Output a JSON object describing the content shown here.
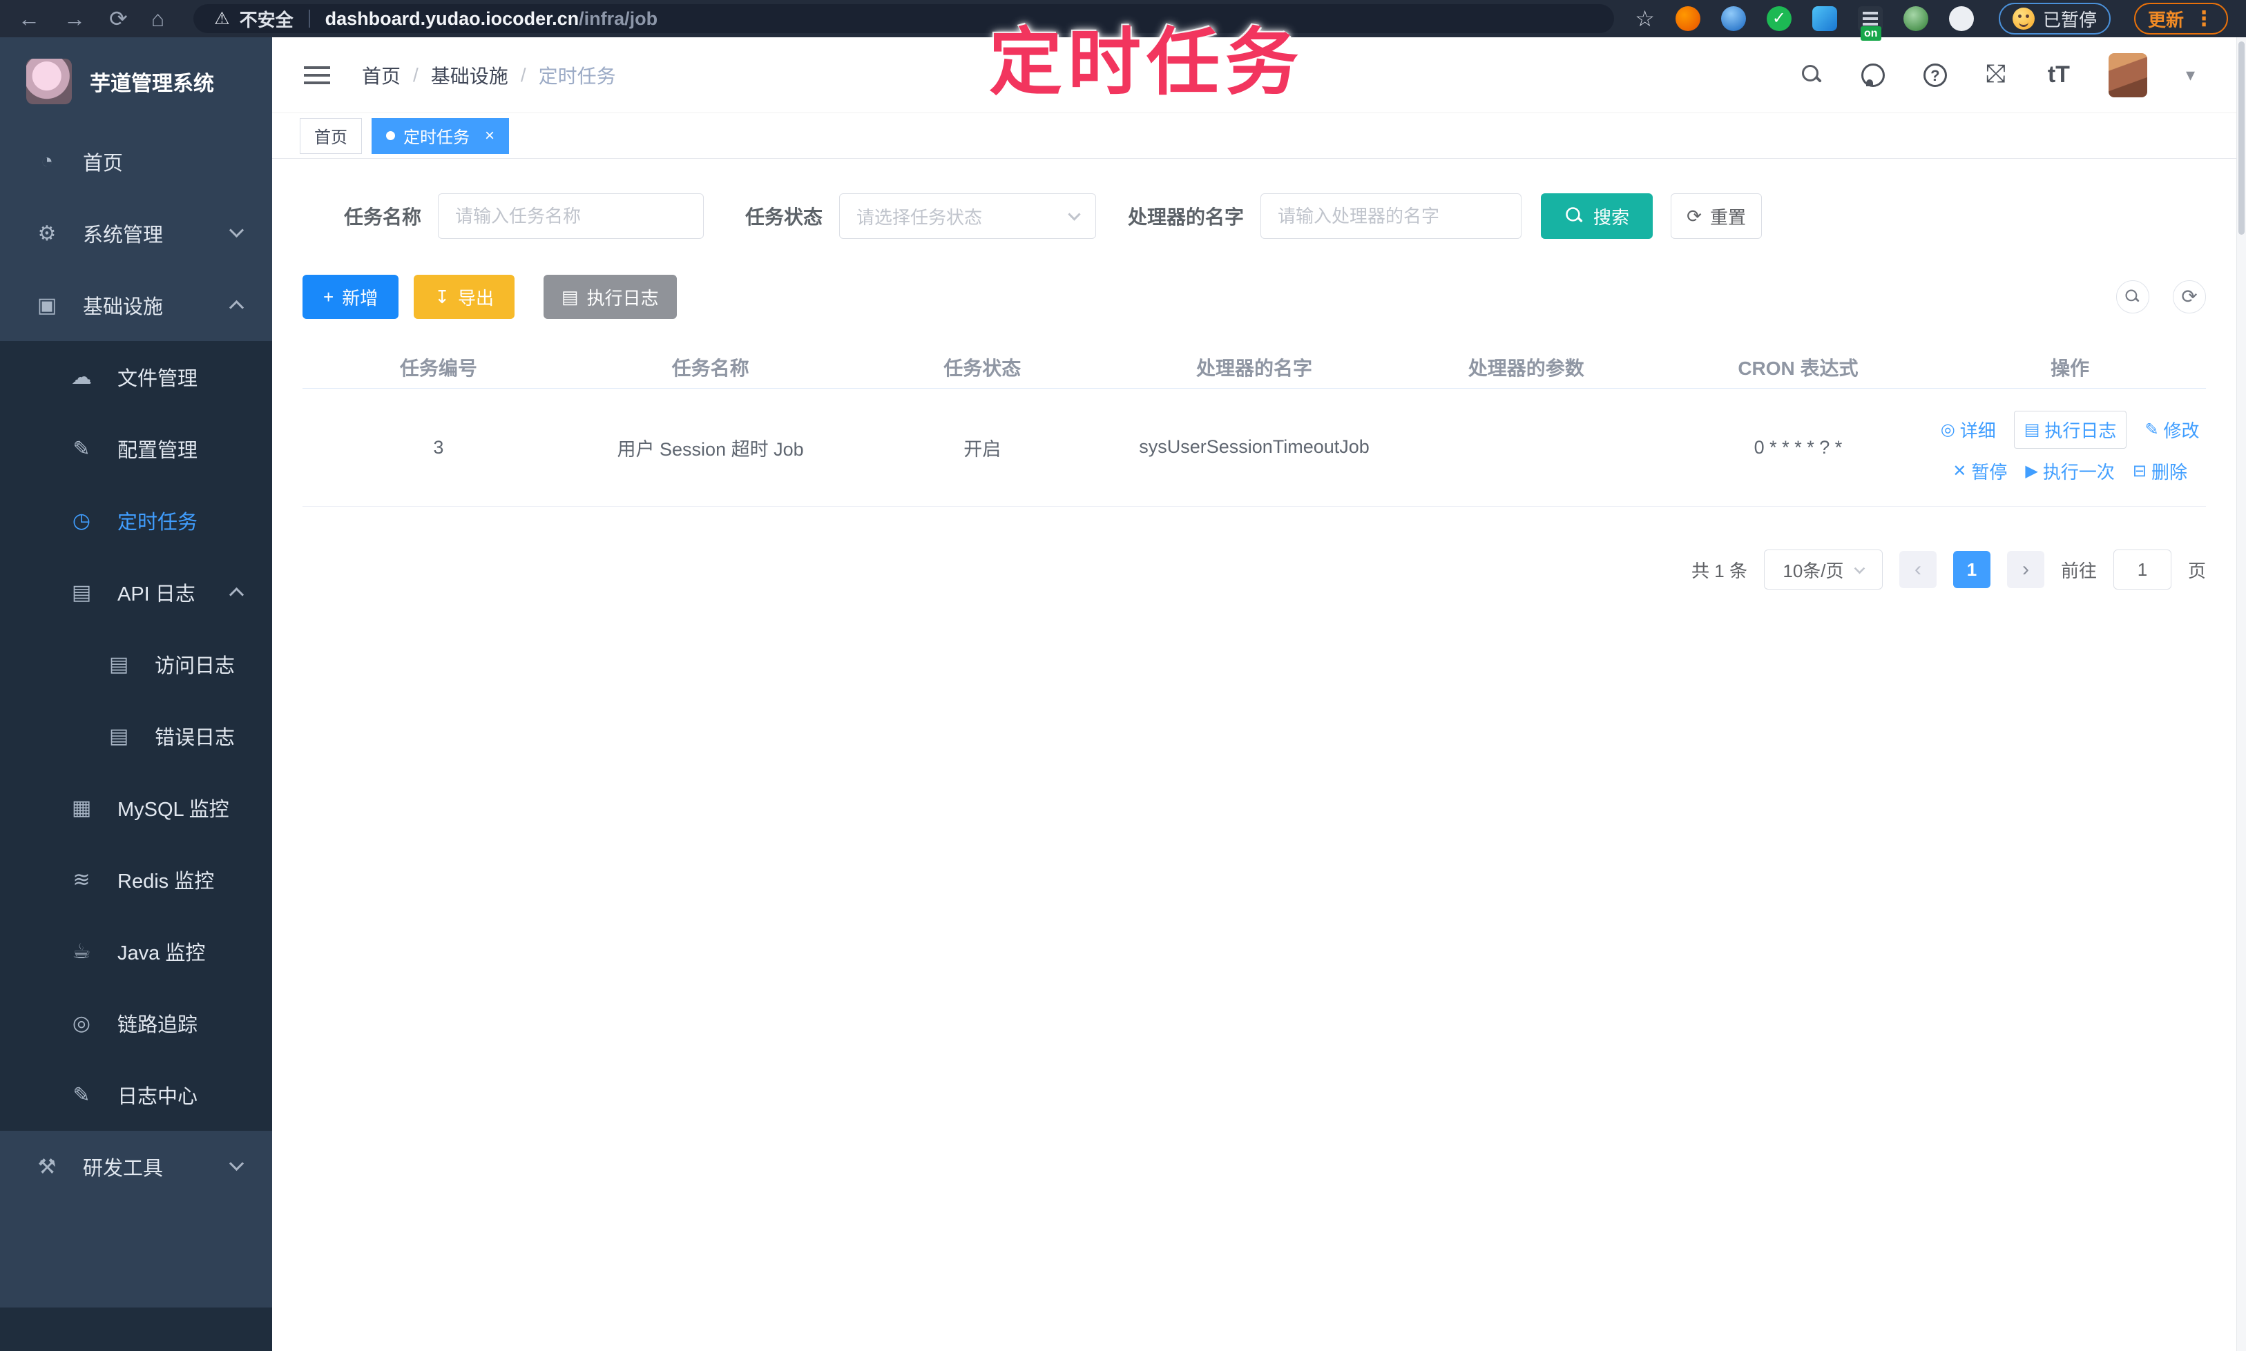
{
  "icons": {
    "back": "←",
    "forward": "→",
    "reload": "⟳",
    "home": "⌂",
    "warning": "⚠",
    "star": "☆",
    "kebab": "⋮",
    "check": "✓",
    "caret_down": "▾",
    "prev": "‹",
    "next": "›",
    "reset": "⟳",
    "add": "+",
    "export": "↧",
    "list": "▤",
    "close": "×"
  },
  "browser": {
    "security_label": "不安全",
    "url_host": "dashboard.yudao.iocoder.cn",
    "url_path": "/infra/job",
    "extension_badge": "on",
    "paused_label": "已暂停",
    "update_label": "更新"
  },
  "watermark": "定时任务",
  "sidebar": {
    "title": "芋道管理系统",
    "items": [
      {
        "label": "首页",
        "glyph": "◔"
      },
      {
        "label": "系统管理",
        "glyph": "⚙"
      },
      {
        "label": "基础设施",
        "glyph": "▣"
      },
      {
        "label": "文件管理",
        "glyph": "☁"
      },
      {
        "label": "配置管理",
        "glyph": "✎"
      },
      {
        "label": "定时任务",
        "glyph": "◷"
      },
      {
        "label": "API 日志",
        "glyph": "▤"
      },
      {
        "label": "访问日志",
        "glyph": "▤"
      },
      {
        "label": "错误日志",
        "glyph": "▤"
      },
      {
        "label": "MySQL 监控",
        "glyph": "▦"
      },
      {
        "label": "Redis 监控",
        "glyph": "≋"
      },
      {
        "label": "Java 监控",
        "glyph": "☕"
      },
      {
        "label": "链路追踪",
        "glyph": "◎"
      },
      {
        "label": "日志中心",
        "glyph": "✎"
      },
      {
        "label": "研发工具",
        "glyph": "⚒"
      }
    ]
  },
  "breadcrumb": {
    "items": [
      "首页",
      "基础设施",
      "定时任务"
    ],
    "separator": "/"
  },
  "tabs": [
    {
      "label": "首页"
    },
    {
      "label": "定时任务"
    }
  ],
  "filters": {
    "name_label": "任务名称",
    "name_placeholder": "请输入任务名称",
    "status_label": "任务状态",
    "status_placeholder": "请选择任务状态",
    "handler_label": "处理器的名字",
    "handler_placeholder": "请输入处理器的名字",
    "search_label": "搜索",
    "reset_label": "重置"
  },
  "toolbar": {
    "add_label": "新增",
    "export_label": "导出",
    "exec_log_label": "执行日志"
  },
  "table": {
    "columns": [
      "任务编号",
      "任务名称",
      "任务状态",
      "处理器的名字",
      "处理器的参数",
      "CRON 表达式",
      "操作"
    ],
    "rows": [
      {
        "id": "3",
        "name": "用户 Session 超时 Job",
        "status": "开启",
        "handler": "sysUserSessionTimeoutJob",
        "param": "",
        "cron": "0 * * * * ? *"
      }
    ]
  },
  "row_actions": [
    {
      "label": "详细",
      "glyph": "◎"
    },
    {
      "label": "执行日志",
      "glyph": "▤"
    },
    {
      "label": "修改",
      "glyph": "✎"
    },
    {
      "label": "暂停",
      "glyph": "✕"
    },
    {
      "label": "执行一次",
      "glyph": "▶"
    },
    {
      "label": "删除",
      "glyph": "⊟"
    }
  ],
  "pagination": {
    "total": "共 1 条",
    "page_size": "10条/页",
    "current_page": "1",
    "goto_label": "前往",
    "goto_value": "1",
    "page_unit": "页"
  },
  "colors": {
    "accent": "#409eff",
    "search_teal": "#17b3a3",
    "export_orange": "#f7ba2a",
    "info_gray": "#909399",
    "watermark_pink": "#f2355e",
    "sidebar_bg": "#304156",
    "submenu_bg": "#1f2d3d"
  }
}
